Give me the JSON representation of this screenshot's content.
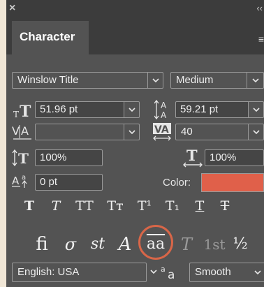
{
  "window": {
    "close_glyph": "×",
    "collapse_glyph": "‹‹"
  },
  "panel": {
    "tab_label": "Character",
    "menu_glyph": "≡"
  },
  "font": {
    "family": "Winslow Title",
    "style": "Medium"
  },
  "size": {
    "value": "51.96 pt"
  },
  "leading": {
    "value": "59.21 pt"
  },
  "kerning": {
    "value": ""
  },
  "tracking": {
    "value": "40"
  },
  "vertical_scale": {
    "value": "100%"
  },
  "horizontal_scale": {
    "value": "100%"
  },
  "baseline_shift": {
    "value": "0 pt"
  },
  "color": {
    "label": "Color:",
    "swatch": "#e0604a"
  },
  "type_styles": {
    "faux_bold": "T",
    "faux_italic": "T",
    "all_caps": "TT",
    "small_caps": "Tт",
    "superscript": "T¹",
    "subscript": "T₁",
    "underline": "T",
    "strikethrough": "T"
  },
  "opentype": {
    "ligatures": "ﬁ",
    "old_style": "σ",
    "swash": "st",
    "stylistic": "A",
    "titling": "aa",
    "contextual": "T",
    "ordinals": "1st",
    "fractions": "½"
  },
  "language": {
    "value": "English: USA"
  },
  "antialias": {
    "value": "Smooth",
    "icon": "aa"
  },
  "accent": {
    "highlight_ring": "#d86648"
  }
}
